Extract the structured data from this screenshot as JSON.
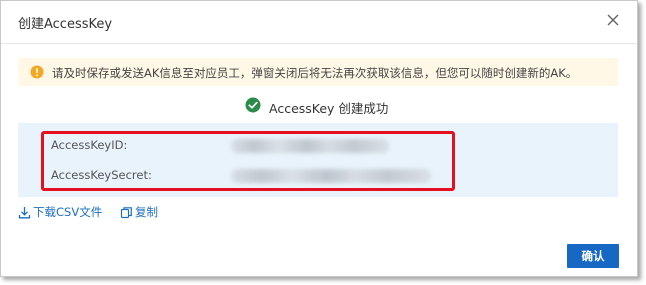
{
  "dialog": {
    "title": "创建AccessKey",
    "notice": "请及时保存或发送AK信息至对应员工，弹窗关闭后将无法再次获取该信息，但您可以随时创建新的AK。",
    "success_message": "AccessKey 创建成功",
    "fields": {
      "id_label": "AccessKeyID:",
      "secret_label": "AccessKeySecret:"
    },
    "actions": {
      "download_label": "下载CSV文件",
      "copy_label": "复制"
    },
    "confirm_label": "确认"
  },
  "colors": {
    "notice_bg": "#fff8e6",
    "warning": "#f5a623",
    "success": "#2a8b4a",
    "key_box_bg": "#e9f3fb",
    "highlight": "#e5101f",
    "link": "#1a6fc2",
    "primary": "#1768c4"
  },
  "icons": {
    "close": "close-icon",
    "warning": "warning-icon",
    "success": "check-circle-icon",
    "download": "download-icon",
    "copy": "copy-icon"
  }
}
